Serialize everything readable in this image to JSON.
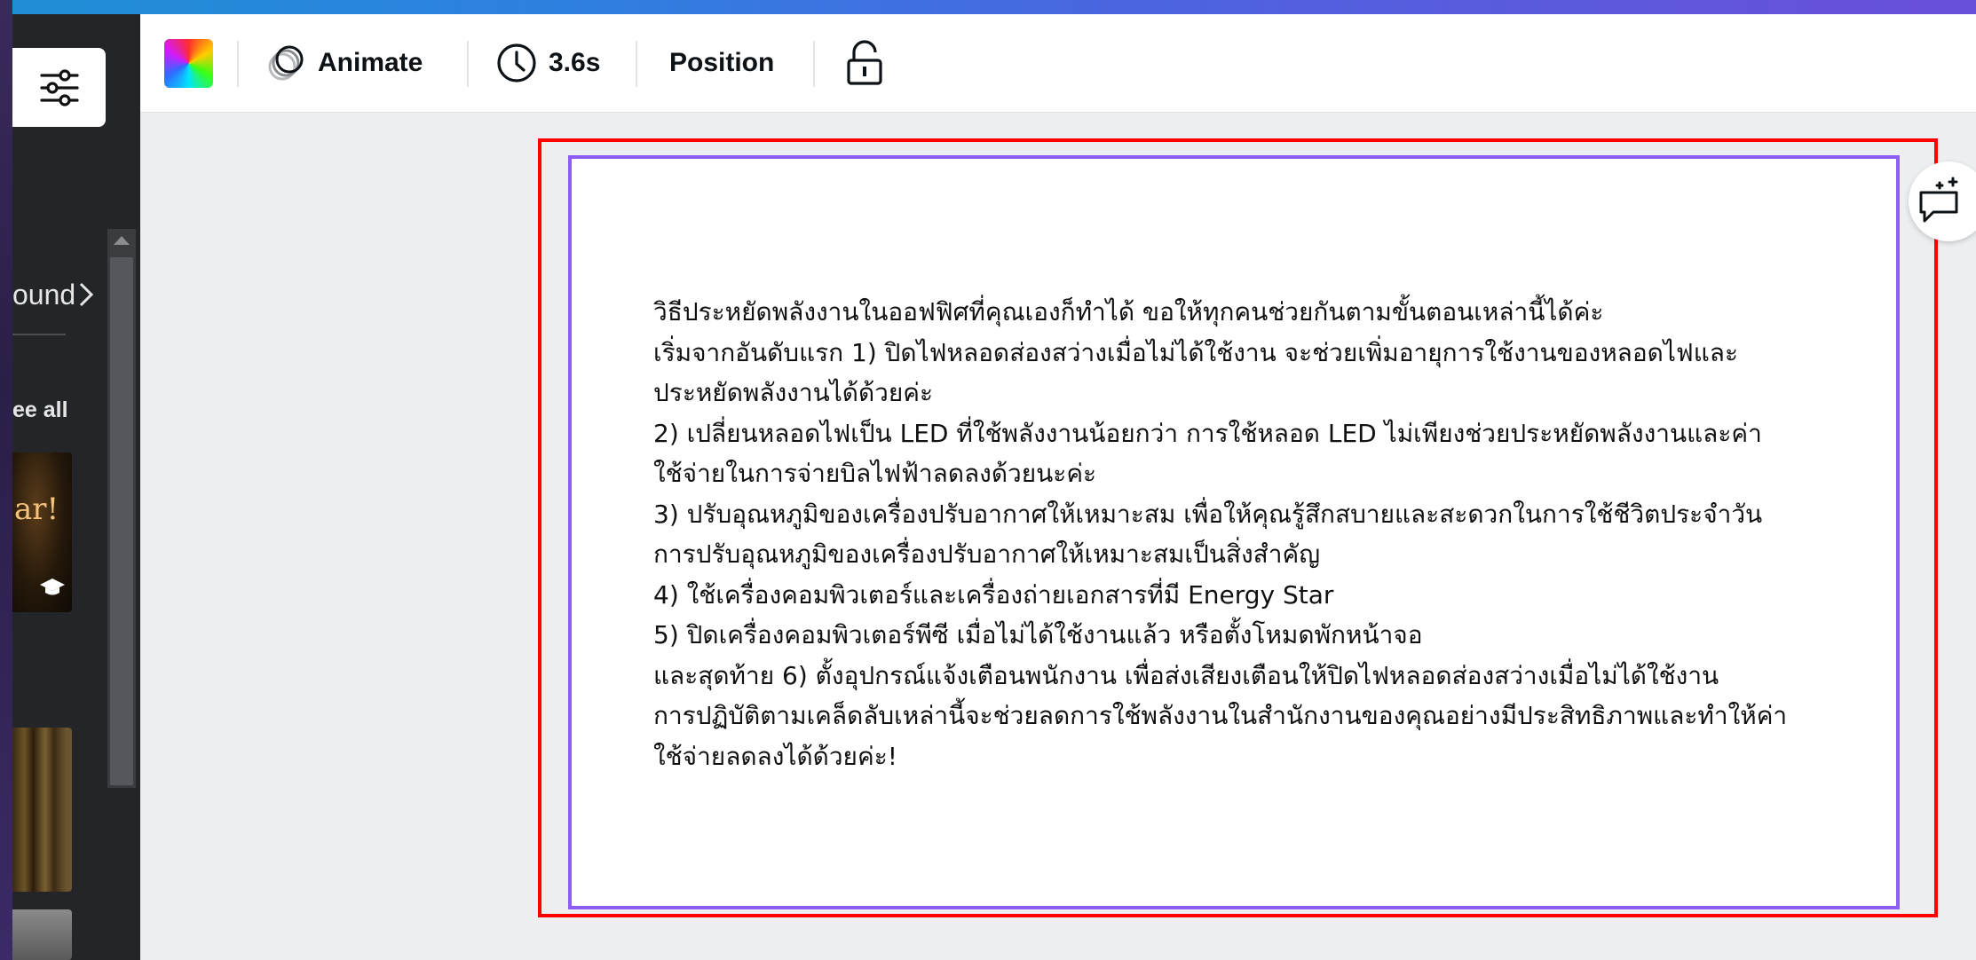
{
  "sidebar": {
    "background_label": "ound",
    "see_all_label": "ee all",
    "thumb_text": "ar!",
    "collapse_icon": "chevron-left-icon"
  },
  "toolbar": {
    "color_icon": "color-picker-icon",
    "animate_label": "Animate",
    "duration_label": "3.6s",
    "position_label": "Position",
    "lock_icon": "lock-icon"
  },
  "canvas": {
    "lines": [
      "วิธีประหยัดพลังงานในออฟฟิศที่คุณเองก็ทำได้ ขอให้ทุกคนช่วยกันตามขั้นตอนเหล่านี้ได้ค่ะ",
      "เริ่มจากอันดับแรก 1) ปิดไฟหลอดส่องสว่างเมื่อไม่ได้ใช้งาน จะช่วยเพิ่มอายุการใช้งานของหลอดไฟและ",
      "ประหยัดพลังงานได้ด้วยค่ะ",
      "2) เปลี่ยนหลอดไฟเป็น LED ที่ใช้พลังงานน้อยกว่า การใช้หลอด LED ไม่เพียงช่วยประหยัดพลังงานและค่า",
      "ใช้จ่ายในการจ่ายบิลไฟฟ้าลดลงด้วยนะค่ะ",
      "3) ปรับอุณหภูมิของเครื่องปรับอากาศให้เหมาะสม เพื่อให้คุณรู้สึกสบายและสะดวกในการใช้ชีวิตประจำวัน",
      "การปรับอุณหภูมิของเครื่องปรับอากาศให้เหมาะสมเป็นสิ่งสำคัญ",
      "4) ใช้เครื่องคอมพิวเตอร์และเครื่องถ่ายเอกสารที่มี Energy Star",
      "5) ปิดเครื่องคอมพิวเตอร์พีซี เมื่อไม่ได้ใช้งานแล้ว หรือตั้งโหมดพักหน้าจอ",
      "และสุดท้าย 6) ตั้งอุปกรณ์แจ้งเตือนพนักงาน เพื่อส่งเสียงเตือนให้ปิดไฟหลอดส่องสว่างเมื่อไม่ได้ใช้งาน",
      "การปฏิบัติตามเคล็ดลับเหล่านี้จะช่วยลดการใช้พลังงานในสำนักงานของคุณอย่างมีประสิทธิภาพและทำให้ค่า",
      "ใช้จ่ายลดลงได้ด้วยค่ะ!"
    ]
  },
  "colors": {
    "selection_red": "#ff0000",
    "page_border_purple": "#8b5cf6",
    "canvas_bg": "#eceef1",
    "side_panel": "#232529"
  }
}
